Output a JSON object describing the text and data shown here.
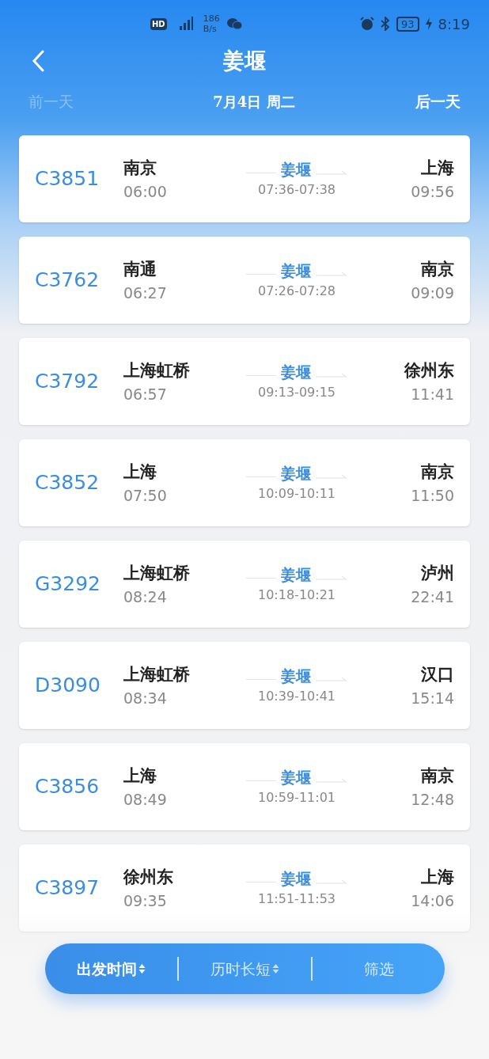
{
  "status_bar": {
    "hd": "HD",
    "speed": "186",
    "speed_unit": "B/s",
    "battery": "93",
    "time": "8:19"
  },
  "header": {
    "title": "姜堰"
  },
  "date_nav": {
    "previous": {
      "label": "前一天",
      "disabled": true
    },
    "date": "7月4日 周二",
    "next": {
      "label": "后一天",
      "disabled": false
    }
  },
  "trains": [
    {
      "number": "C3851",
      "from": "南京",
      "depart": "06:00",
      "via": "姜堰",
      "stop_time": "07:36-07:38",
      "to": "上海",
      "arrive": "09:56"
    },
    {
      "number": "C3762",
      "from": "南通",
      "depart": "06:27",
      "via": "姜堰",
      "stop_time": "07:26-07:28",
      "to": "南京",
      "arrive": "09:09"
    },
    {
      "number": "C3792",
      "from": "上海虹桥",
      "depart": "06:57",
      "via": "姜堰",
      "stop_time": "09:13-09:15",
      "to": "徐州东",
      "arrive": "11:41"
    },
    {
      "number": "C3852",
      "from": "上海",
      "depart": "07:50",
      "via": "姜堰",
      "stop_time": "10:09-10:11",
      "to": "南京",
      "arrive": "11:50"
    },
    {
      "number": "G3292",
      "from": "上海虹桥",
      "depart": "08:24",
      "via": "姜堰",
      "stop_time": "10:18-10:21",
      "to": "泸州",
      "arrive": "22:41"
    },
    {
      "number": "D3090",
      "from": "上海虹桥",
      "depart": "08:34",
      "via": "姜堰",
      "stop_time": "10:39-10:41",
      "to": "汉口",
      "arrive": "15:14"
    },
    {
      "number": "C3856",
      "from": "上海",
      "depart": "08:49",
      "via": "姜堰",
      "stop_time": "10:59-11:01",
      "to": "南京",
      "arrive": "12:48"
    },
    {
      "number": "C3897",
      "from": "徐州东",
      "depart": "09:35",
      "via": "姜堰",
      "stop_time": "11:51-11:53",
      "to": "上海",
      "arrive": "14:06"
    }
  ],
  "bottom_bar": [
    {
      "kind": "sort",
      "label": "出发时间",
      "selected": true
    },
    {
      "kind": "sort",
      "label": "历时长短",
      "selected": false
    },
    {
      "kind": "filter",
      "label": "筛选",
      "selected": false
    }
  ]
}
